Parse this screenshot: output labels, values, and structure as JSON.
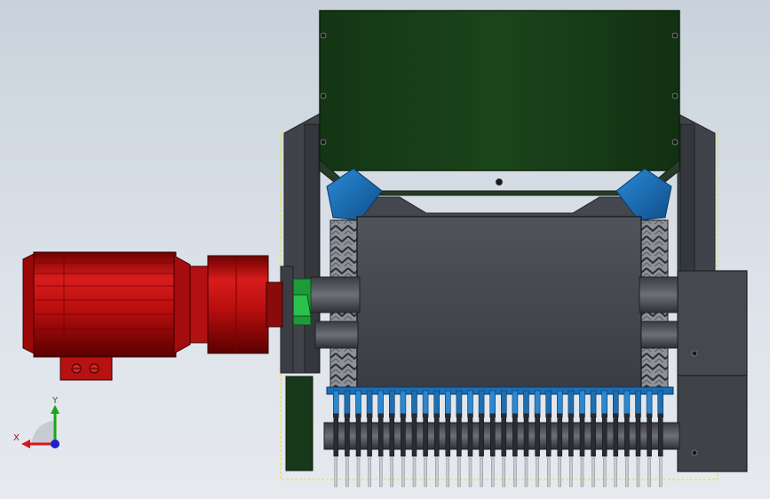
{
  "viewport": {
    "background_top": "#c9d2dc",
    "background_bottom": "#e6eaef"
  },
  "triad": {
    "x_label": "X",
    "y_label": "Y",
    "x_color": "#d8161b",
    "y_color": "#1aa51a",
    "z_color": "#2020d0"
  },
  "model": {
    "motor_color": "#cc1111",
    "hopper_color": "#173d17",
    "frame_color": "#3c3f44",
    "housing_color": "#4a4d52",
    "bearing_color": "#1a6fb8",
    "coupling_color": "#1f9a3a",
    "weld_outline_color": "#e8e020",
    "rotor_teeth_count": 30
  }
}
